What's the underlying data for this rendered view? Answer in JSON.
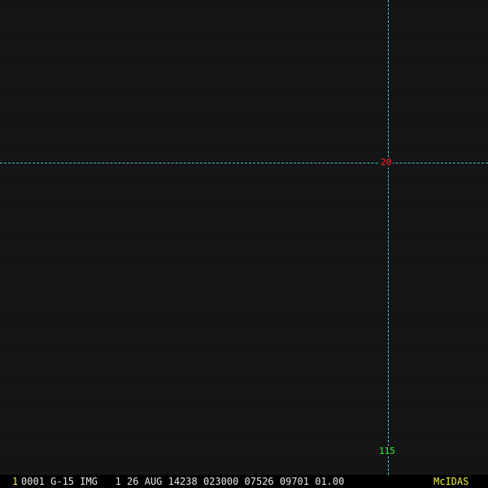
{
  "overlay": {
    "latitude_label": "20",
    "longitude_label": "115",
    "colors": {
      "grid_line": "#4ec9d6",
      "latitude_label": "#ff2a2a",
      "longitude_label": "#2dfa3a",
      "background": "#161616"
    }
  },
  "status_bar": {
    "frame_number": "1",
    "info": "0001 G-15 IMG   1 26 AUG 14238 023000 07526 09701 01.00",
    "app_name": "McIDAS",
    "colors": {
      "frame_number": "#f5f53a",
      "info": "#e8e8e8",
      "app_name": "#f5f53a"
    }
  }
}
